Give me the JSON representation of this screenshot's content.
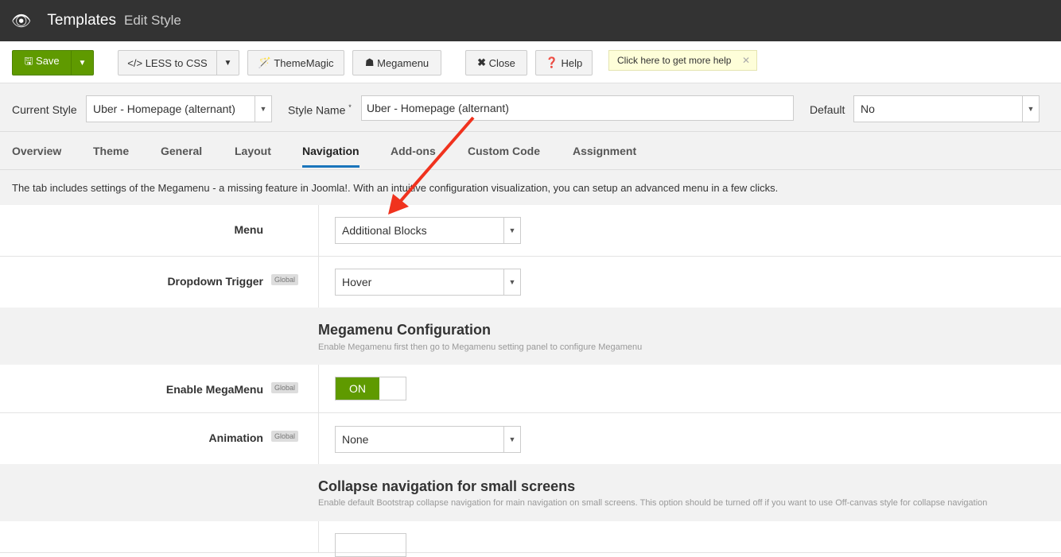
{
  "header": {
    "title": "Templates",
    "subtitle": "Edit Style"
  },
  "toolbar": {
    "save": "Save",
    "less": "LESS to CSS",
    "thememagic": "ThemeMagic",
    "megamenu": "Megamenu",
    "close": "Close",
    "help": "Help",
    "tip": "Click here to get more help"
  },
  "style": {
    "current_label": "Current Style",
    "current_value": "Uber - Homepage (alternant)",
    "name_label": "Style Name",
    "name_value": "Uber - Homepage (alternant)",
    "default_label": "Default",
    "default_value": "No"
  },
  "tabs": [
    "Overview",
    "Theme",
    "General",
    "Layout",
    "Navigation",
    "Add-ons",
    "Custom Code",
    "Assignment"
  ],
  "description": "The tab includes settings of the Megamenu - a missing feature in Joomla!. With an intuitive configuration visualization, you can setup an advanced menu in a few clicks.",
  "fields": {
    "menu": {
      "label": "Menu",
      "value": "Additional Blocks"
    },
    "trigger": {
      "label": "Dropdown Trigger",
      "badge": "Global",
      "value": "Hover"
    },
    "mega_section": {
      "title": "Megamenu Configuration",
      "desc": "Enable Megamenu first then go to Megamenu setting panel to configure Megamenu"
    },
    "enable": {
      "label": "Enable MegaMenu",
      "badge": "Global",
      "value": "ON"
    },
    "animation": {
      "label": "Animation",
      "badge": "Global",
      "value": "None"
    },
    "collapse_section": {
      "title": "Collapse navigation for small screens",
      "desc": "Enable default Bootstrap collapse navigation for main navigation on small screens. This option should be turned off if you want to use Off-canvas style for collapse navigation"
    }
  }
}
